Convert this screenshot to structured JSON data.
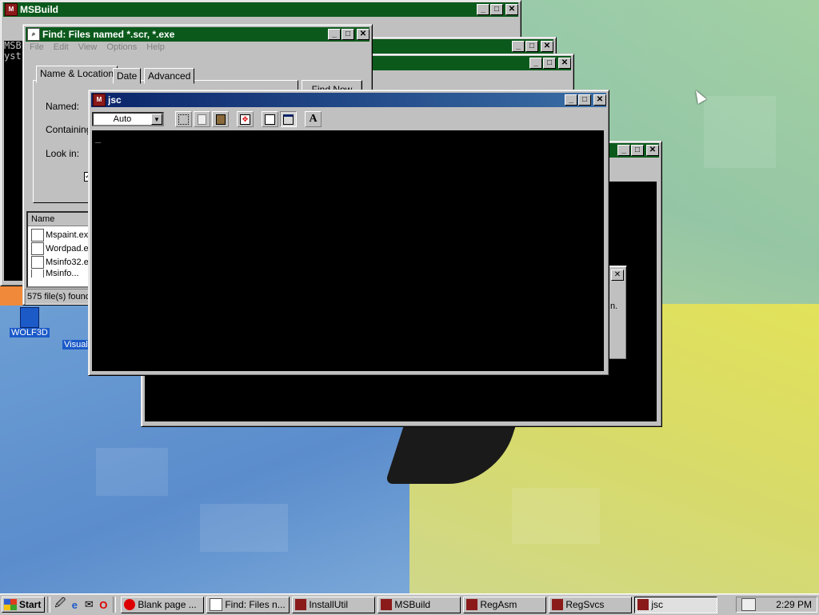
{
  "windows": {
    "msbuild": {
      "title": "MSBuild",
      "console_text": "MSB\nyst"
    },
    "find": {
      "title": "Find: Files named *.scr, *.exe",
      "menu": [
        "File",
        "Edit",
        "View",
        "Options",
        "Help"
      ],
      "tabs": [
        "Name & Location",
        "Date",
        "Advanced"
      ],
      "labels": {
        "named": "Named:",
        "containing": "Containing",
        "look_in": "Look in:"
      },
      "find_now": "Find Now",
      "list_header": "Name",
      "files": [
        "Mspaint.exe",
        "Wordpad.exe",
        "Msinfo32.exe",
        "Msinfo..."
      ],
      "status": "575 file(s) found"
    },
    "jsc": {
      "title": "jsc",
      "font_size": "Auto",
      "toolbar_icons": [
        "mark-icon",
        "copy-icon",
        "paste-icon",
        "fullscreen-icon",
        "properties-icon",
        "background-icon",
        "font-icon"
      ],
      "font_glyph": "A",
      "console_text": "_"
    },
    "dialog_fragment_text": "n."
  },
  "desktop_icons": [
    {
      "label": "WOLF3D",
      "icon": "wolf3d-icon"
    },
    {
      "label": "Visual",
      "icon": "visual-icon"
    }
  ],
  "taskbar": {
    "start_label": "Start",
    "quick_launch": [
      "desktop-icon",
      "ie-icon",
      "outlook-icon",
      "opera-icon"
    ],
    "tasks": [
      {
        "label": "Blank page ...",
        "active": false
      },
      {
        "label": "Find: Files n...",
        "active": false
      },
      {
        "label": "InstallUtil",
        "active": false
      },
      {
        "label": "MSBuild",
        "active": false
      },
      {
        "label": "RegAsm",
        "active": false
      },
      {
        "label": "RegSvcs",
        "active": false
      },
      {
        "label": "jsc",
        "active": true
      }
    ],
    "clock": "2:29 PM"
  },
  "colors": {
    "active_title": "#0a246a",
    "inactive_title": "#0b5a1c",
    "face": "#c0c0c0"
  }
}
